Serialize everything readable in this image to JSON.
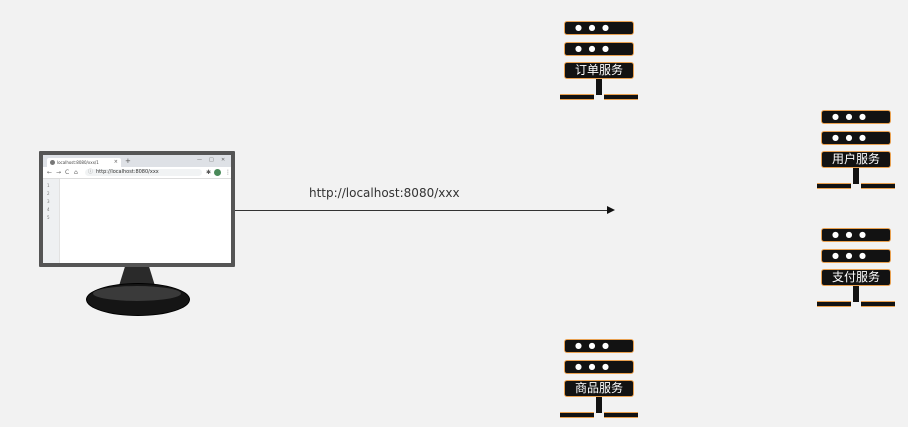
{
  "browser": {
    "tab_title": "localhost:8080/xxx/1",
    "new_tab_symbol": "+",
    "tab_close_symbol": "×",
    "window_controls": [
      "—",
      "□",
      "✕"
    ],
    "nav_symbols": [
      "←",
      "→",
      "C",
      "⌂"
    ],
    "address_url": "http://localhost:8080/xxx",
    "line_numbers": [
      "1",
      "2",
      "3",
      "4",
      "5"
    ],
    "icons": [
      "favicon-icon",
      "lock-icon",
      "extension-icon",
      "profile-icon",
      "menu-icon"
    ]
  },
  "request": {
    "url_label": "http://localhost:8080/xxx"
  },
  "services": [
    {
      "label": "订单服务"
    },
    {
      "label": "用户服务"
    },
    {
      "label": "支付服务"
    },
    {
      "label": "商品服务"
    }
  ],
  "server_rack_dots": "● ● ●",
  "colors": {
    "background": "#f2f2f2",
    "server_fill": "#121212",
    "server_accent": "#e8a050",
    "monitor_bezel": "#555555"
  }
}
